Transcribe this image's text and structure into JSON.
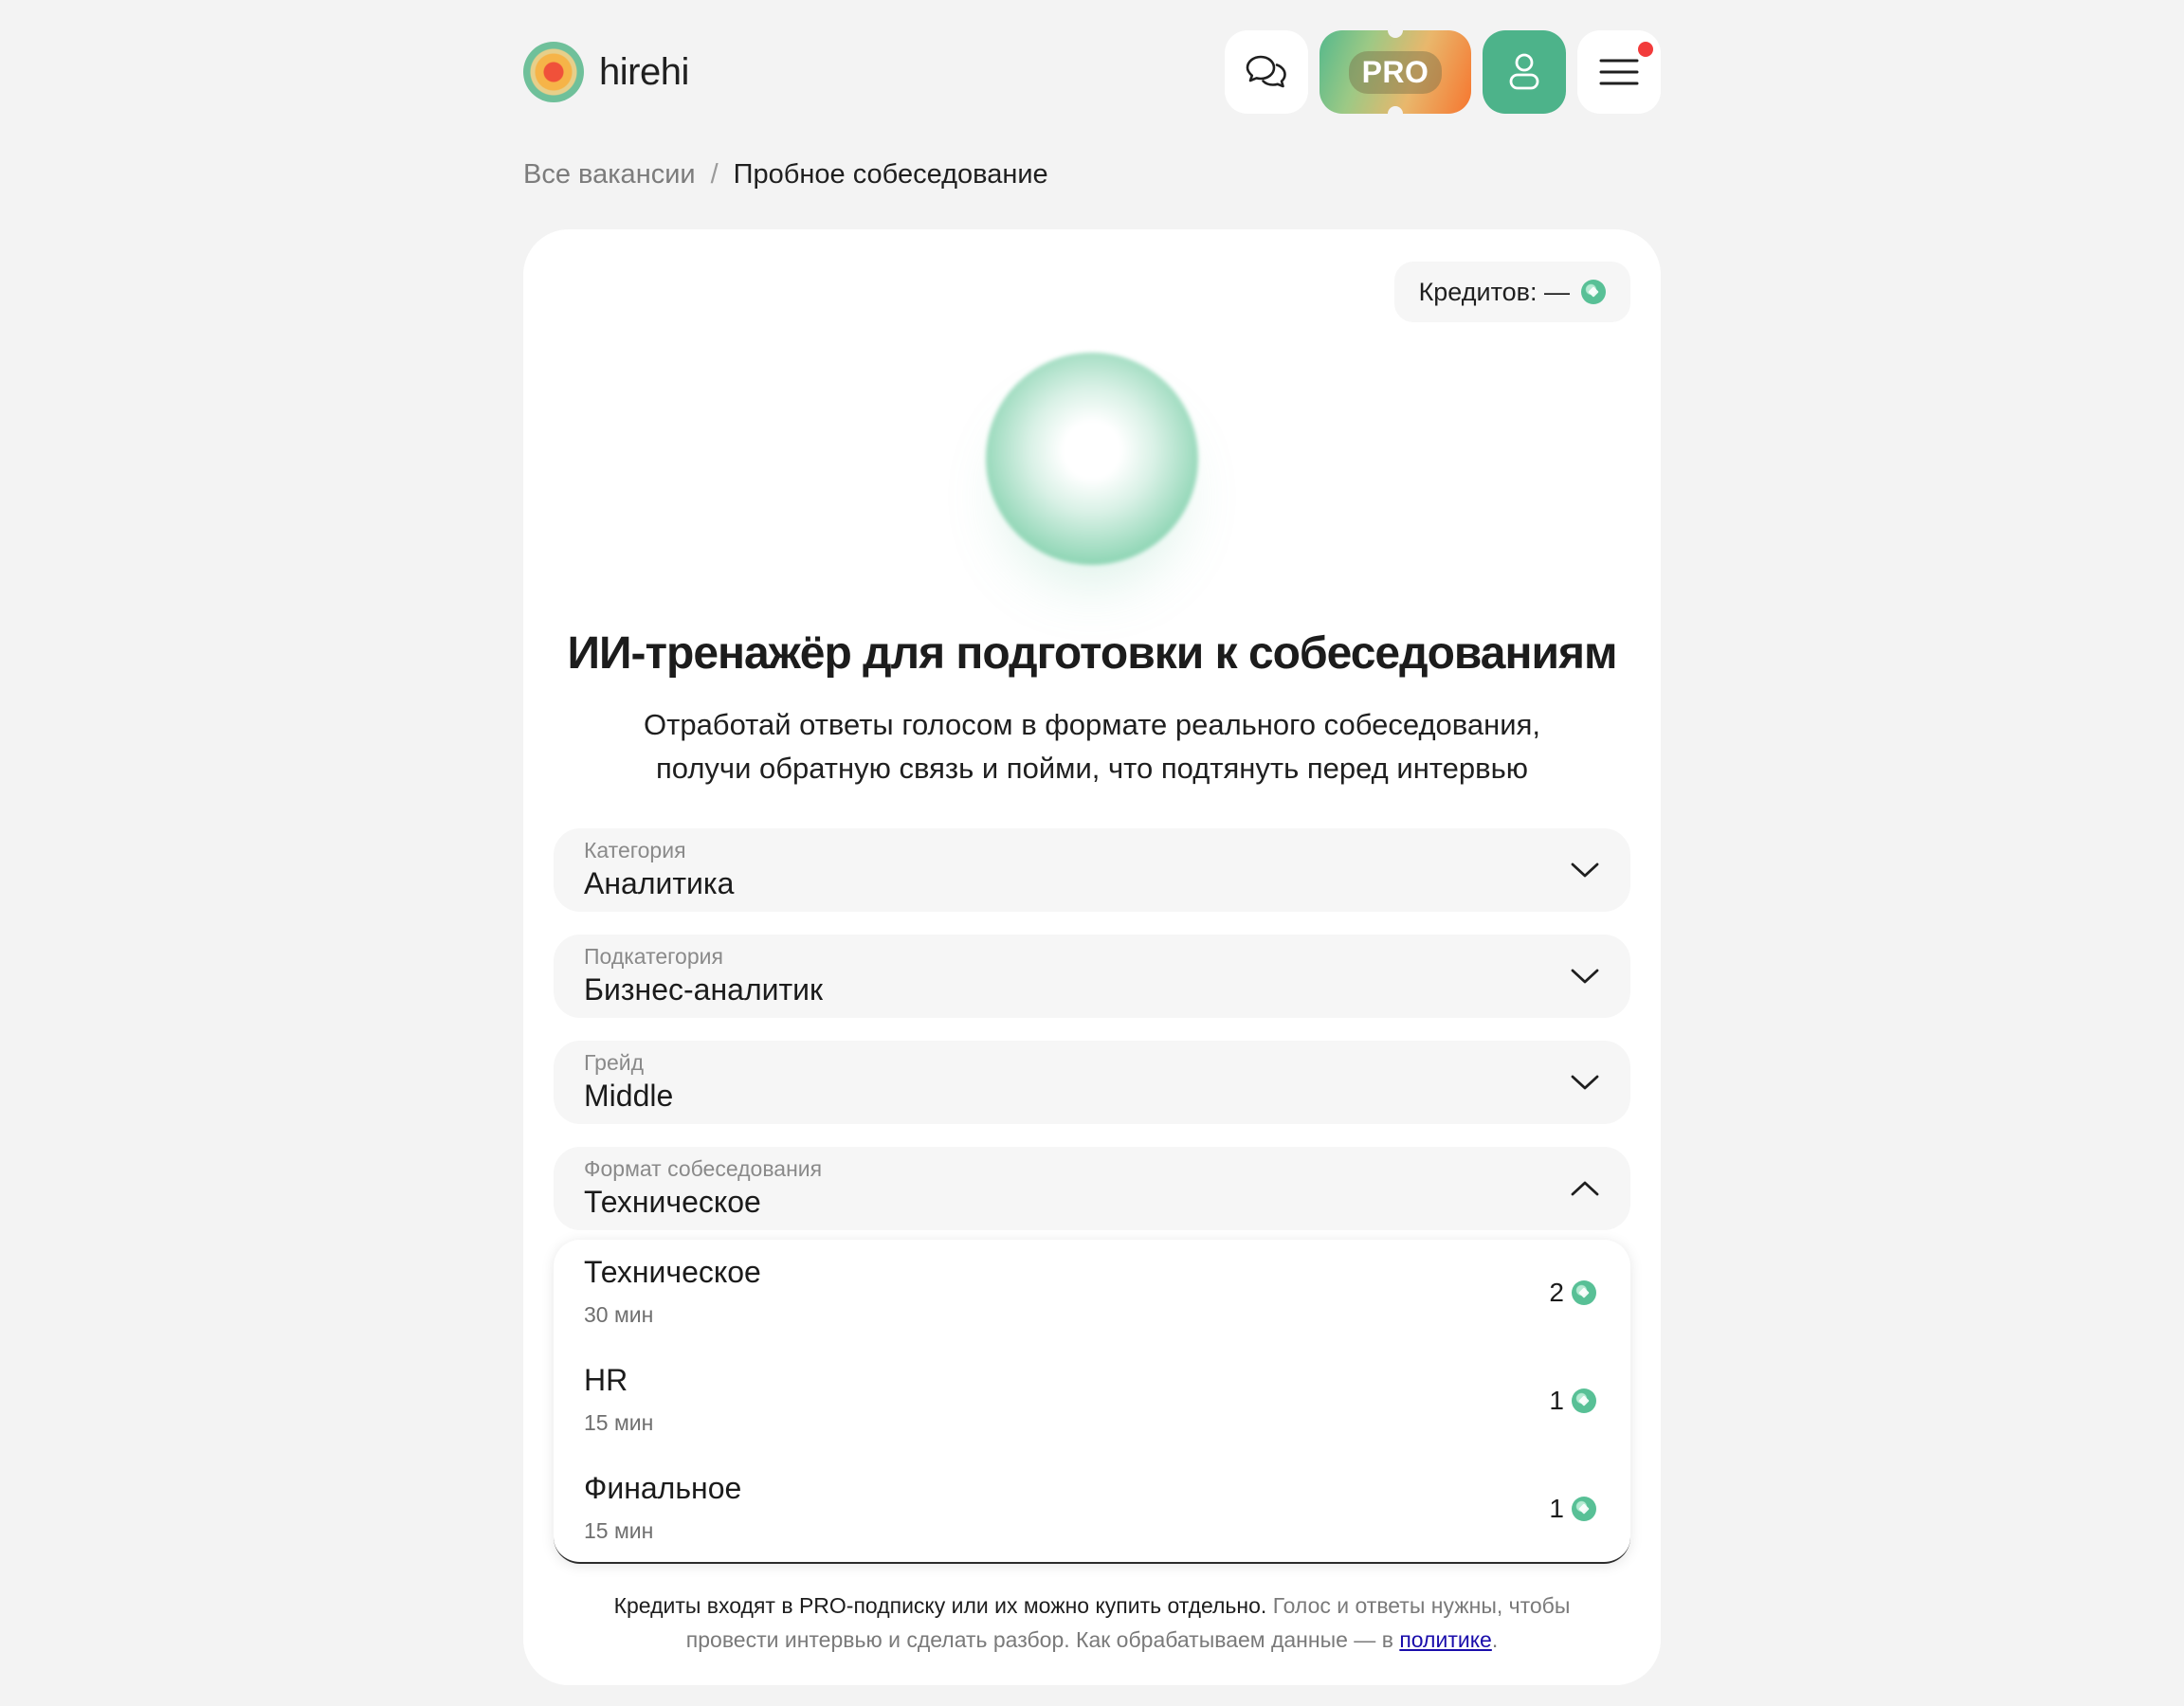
{
  "header": {
    "logo_text": "hirehi",
    "pro_label": "PRO"
  },
  "breadcrumb": {
    "parent": "Все вакансии",
    "separator": "/",
    "current": "Пробное собеседование"
  },
  "credits": {
    "label": "Кредитов: —"
  },
  "hero": {
    "title": "ИИ-тренажёр для подготовки к собеседованиям",
    "subtitle_line1": "Отработай ответы голосом в формате реального собеседования,",
    "subtitle_line2": "получи обратную связь и пойми, что подтянуть перед интервью"
  },
  "form": {
    "category": {
      "label": "Категория",
      "value": "Аналитика"
    },
    "subcategory": {
      "label": "Подкатегория",
      "value": "Бизнес-аналитик"
    },
    "grade": {
      "label": "Грейд",
      "value": "Middle"
    },
    "format": {
      "label": "Формат собеседования",
      "value": "Техническое",
      "expanded": true
    }
  },
  "format_options": [
    {
      "title": "Техническое",
      "duration": "30 мин",
      "cost": "2"
    },
    {
      "title": "HR",
      "duration": "15 мин",
      "cost": "1"
    },
    {
      "title": "Финальное",
      "duration": "15 мин",
      "cost": "1"
    }
  ],
  "note": {
    "strong": "Кредиты входят в PRO-подписку или их можно купить отдельно.",
    "text": " Голос и ответы нужны, чтобы провести интервью и сделать разбор. Как обрабатываем данные — в ",
    "link": "политике",
    "end": "."
  },
  "colors": {
    "accent": "#4db38a",
    "background": "#f3f3f3",
    "notification": "#f23b3b"
  }
}
